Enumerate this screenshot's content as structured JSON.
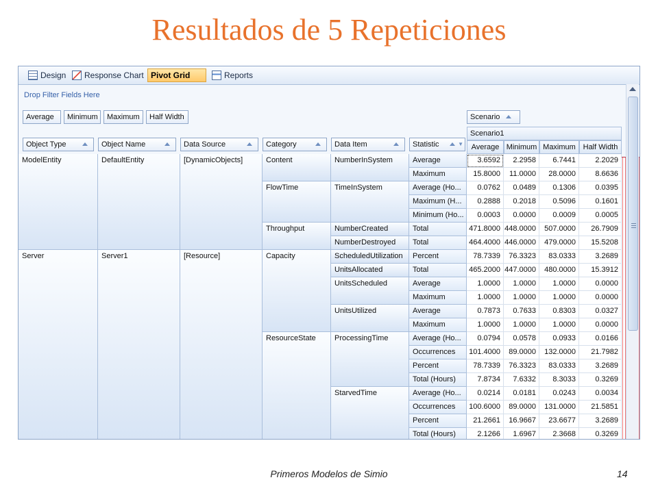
{
  "slide": {
    "title": "Resultados de 5 Repeticiones",
    "footer": "Primeros Modelos de Simio",
    "page": "14"
  },
  "tabs": [
    {
      "label": "Design",
      "icon": "design-icon"
    },
    {
      "label": "Response Chart",
      "icon": "chart-icon"
    },
    {
      "label": "Pivot Grid",
      "icon": "grid-icon",
      "active": true
    },
    {
      "label": "Reports",
      "icon": "report-icon"
    }
  ],
  "filter_area": "Drop Filter Fields Here",
  "data_fields": [
    "Average",
    "Minimum",
    "Maximum",
    "Half Width"
  ],
  "column_field": "Scenario",
  "scenario_value": "Scenario1",
  "row_fields": [
    "Object Type",
    "Object Name",
    "Data Source",
    "Category",
    "Data Item",
    "Statistic"
  ],
  "value_headers": [
    "Average",
    "Minimum",
    "Maximum",
    "Half Width"
  ],
  "groups": [
    {
      "object_type": "ModelEntity",
      "object_name": "DefaultEntity",
      "data_source": "[DynamicObjects]",
      "categories": [
        {
          "name": "Content",
          "items": [
            {
              "name": "NumberInSystem",
              "rows": [
                {
                  "stat": "Average",
                  "values": [
                    "3.6592",
                    "2.2958",
                    "6.7441",
                    "2.2029"
                  ]
                },
                {
                  "stat": "Maximum",
                  "values": [
                    "15.8000",
                    "11.0000",
                    "28.0000",
                    "8.6636"
                  ]
                }
              ]
            }
          ]
        },
        {
          "name": "FlowTime",
          "items": [
            {
              "name": "TimeInSystem",
              "rows": [
                {
                  "stat": "Average (Ho...",
                  "values": [
                    "0.0762",
                    "0.0489",
                    "0.1306",
                    "0.0395"
                  ]
                },
                {
                  "stat": "Maximum (H...",
                  "values": [
                    "0.2888",
                    "0.2018",
                    "0.5096",
                    "0.1601"
                  ]
                },
                {
                  "stat": "Minimum (Ho...",
                  "values": [
                    "0.0003",
                    "0.0000",
                    "0.0009",
                    "0.0005"
                  ]
                }
              ]
            }
          ]
        },
        {
          "name": "Throughput",
          "items": [
            {
              "name": "NumberCreated",
              "rows": [
                {
                  "stat": "Total",
                  "values": [
                    "471.8000",
                    "448.0000",
                    "507.0000",
                    "26.7909"
                  ]
                }
              ]
            },
            {
              "name": "NumberDestroyed",
              "rows": [
                {
                  "stat": "Total",
                  "values": [
                    "464.4000",
                    "446.0000",
                    "479.0000",
                    "15.5208"
                  ]
                }
              ]
            }
          ]
        }
      ]
    },
    {
      "object_type": "Server",
      "object_name": "Server1",
      "data_source": "[Resource]",
      "categories": [
        {
          "name": "Capacity",
          "items": [
            {
              "name": "ScheduledUtilization",
              "rows": [
                {
                  "stat": "Percent",
                  "values": [
                    "78.7339",
                    "76.3323",
                    "83.0333",
                    "3.2689"
                  ]
                }
              ]
            },
            {
              "name": "UnitsAllocated",
              "rows": [
                {
                  "stat": "Total",
                  "values": [
                    "465.2000",
                    "447.0000",
                    "480.0000",
                    "15.3912"
                  ]
                }
              ]
            },
            {
              "name": "UnitsScheduled",
              "rows": [
                {
                  "stat": "Average",
                  "values": [
                    "1.0000",
                    "1.0000",
                    "1.0000",
                    "0.0000"
                  ]
                },
                {
                  "stat": "Maximum",
                  "values": [
                    "1.0000",
                    "1.0000",
                    "1.0000",
                    "0.0000"
                  ]
                }
              ]
            },
            {
              "name": "UnitsUtilized",
              "rows": [
                {
                  "stat": "Average",
                  "values": [
                    "0.7873",
                    "0.7633",
                    "0.8303",
                    "0.0327"
                  ]
                },
                {
                  "stat": "Maximum",
                  "values": [
                    "1.0000",
                    "1.0000",
                    "1.0000",
                    "0.0000"
                  ]
                }
              ]
            }
          ]
        },
        {
          "name": "ResourceState",
          "items": [
            {
              "name": "ProcessingTime",
              "rows": [
                {
                  "stat": "Average (Ho...",
                  "values": [
                    "0.0794",
                    "0.0578",
                    "0.0933",
                    "0.0166"
                  ]
                },
                {
                  "stat": "Occurrences",
                  "values": [
                    "101.4000",
                    "89.0000",
                    "132.0000",
                    "21.7982"
                  ]
                },
                {
                  "stat": "Percent",
                  "values": [
                    "78.7339",
                    "76.3323",
                    "83.0333",
                    "3.2689"
                  ]
                },
                {
                  "stat": "Total (Hours)",
                  "values": [
                    "7.8734",
                    "7.6332",
                    "8.3033",
                    "0.3269"
                  ]
                }
              ]
            },
            {
              "name": "StarvedTime",
              "rows": [
                {
                  "stat": "Average (Ho...",
                  "values": [
                    "0.0214",
                    "0.0181",
                    "0.0243",
                    "0.0034"
                  ]
                },
                {
                  "stat": "Occurrences",
                  "values": [
                    "100.6000",
                    "89.0000",
                    "131.0000",
                    "21.5851"
                  ]
                },
                {
                  "stat": "Percent",
                  "values": [
                    "21.2661",
                    "16.9667",
                    "23.6677",
                    "3.2689"
                  ]
                },
                {
                  "stat": "Total (Hours)",
                  "values": [
                    "2.1266",
                    "1.6967",
                    "2.3668",
                    "0.3269"
                  ]
                }
              ]
            }
          ]
        }
      ]
    }
  ]
}
